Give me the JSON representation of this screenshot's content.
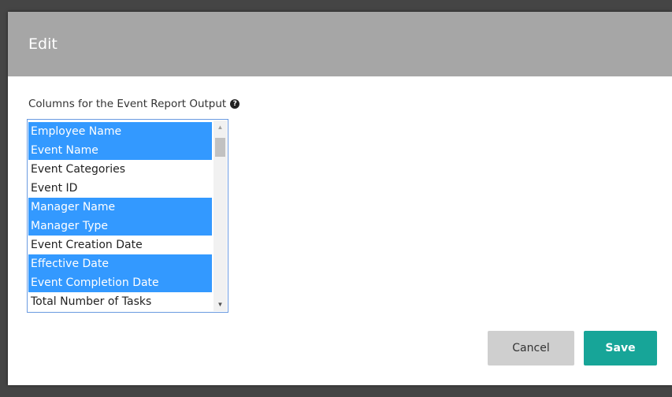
{
  "modal": {
    "title": "Edit"
  },
  "field": {
    "label": "Columns for the Event Report Output",
    "help_icon": "question-circle-icon"
  },
  "listbox": {
    "options": [
      {
        "label": "Employee Name",
        "selected": true
      },
      {
        "label": "Event Name",
        "selected": true
      },
      {
        "label": "Event Categories",
        "selected": false
      },
      {
        "label": "Event ID",
        "selected": false
      },
      {
        "label": "Manager Name",
        "selected": true
      },
      {
        "label": "Manager Type",
        "selected": true
      },
      {
        "label": "Event Creation Date",
        "selected": false
      },
      {
        "label": "Effective Date",
        "selected": true
      },
      {
        "label": "Event Completion Date",
        "selected": true
      },
      {
        "label": "Total Number of Tasks",
        "selected": false
      }
    ]
  },
  "buttons": {
    "cancel": "Cancel",
    "save": "Save"
  },
  "colors": {
    "header": "#a6a6a6",
    "selection": "#3399ff",
    "save": "#17a598",
    "cancel": "#cfcfcf"
  }
}
